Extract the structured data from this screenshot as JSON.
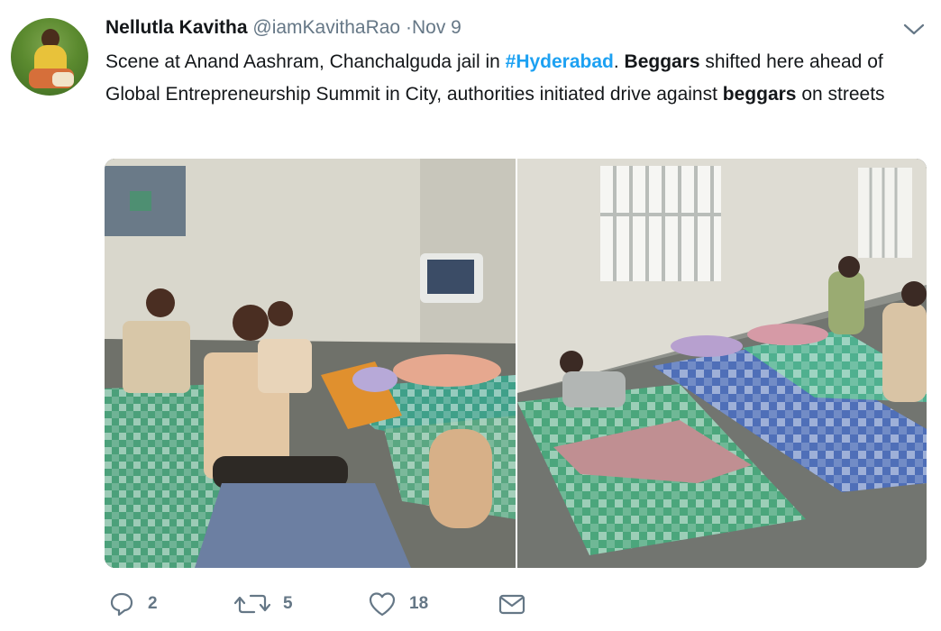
{
  "tweet": {
    "display_name": "Nellutla Kavitha",
    "handle": "@iamKavithaRao",
    "separator": "·",
    "date": "Nov 9",
    "text": {
      "part1": "Scene at Anand Aashram, Chanchalguda jail in ",
      "hashtag": "#Hyderabad",
      "part2": ". ",
      "bold1": "Beggars",
      "part3": " shifted here ahead of Global Entrepreneurship Summit in City, authorities initiated drive against ",
      "bold2": "beggars",
      "part4": " on streets"
    },
    "media": [
      {
        "icon": "photo-people-tv-room"
      },
      {
        "icon": "photo-people-sleeping-mats"
      }
    ],
    "actions": {
      "reply_count": "2",
      "retweet_count": "5",
      "like_count": "18"
    }
  },
  "icons": {
    "avatar": "avatar-image",
    "more": "chevron-down-icon",
    "reply": "reply-icon",
    "retweet": "retweet-icon",
    "like": "heart-icon",
    "dm": "envelope-icon"
  },
  "colors": {
    "text": "#14171a",
    "secondary": "#657786",
    "link": "#1da1f2"
  }
}
